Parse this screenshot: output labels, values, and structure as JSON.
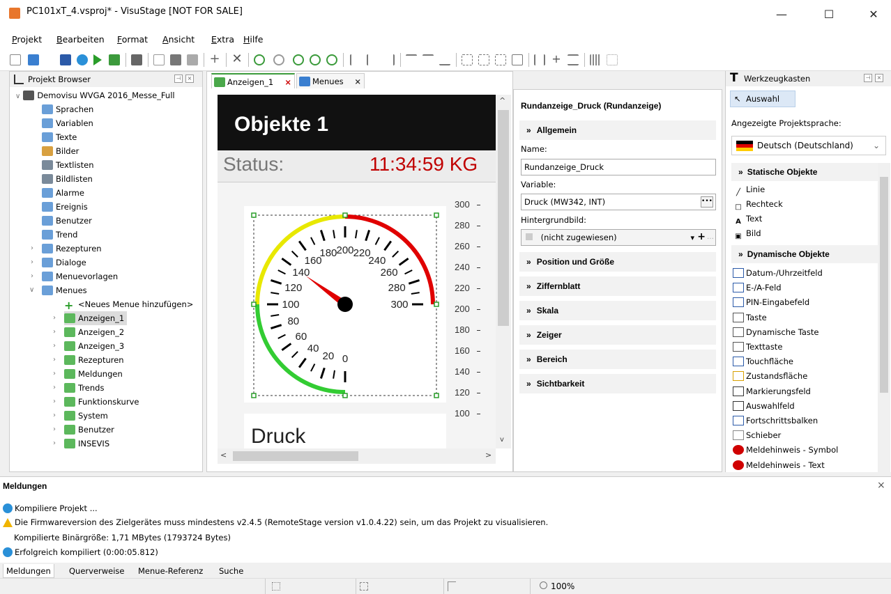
{
  "window": {
    "title": "PC101xT_4.vsproj* - VisuStage [NOT FOR SALE]",
    "min": "—",
    "max": "☐",
    "close": "✕"
  },
  "menubar": [
    {
      "first": "P",
      "rest": "rojekt"
    },
    {
      "first": "B",
      "rest": "earbeiten"
    },
    {
      "first": "F",
      "rest": "ormat"
    },
    {
      "first": "A",
      "rest": "nsicht"
    },
    {
      "first": "E",
      "rest": "xtra"
    },
    {
      "first": "H",
      "rest": "ilfe"
    }
  ],
  "project_browser": {
    "title": "Projekt Browser",
    "root": "Demovisu WVGA 2016_Messe_Full",
    "items": [
      "Sprachen",
      "Variablen",
      "Texte",
      "Bilder",
      "Textlisten",
      "Bildlisten",
      "Alarme",
      "Ereignis",
      "Benutzer",
      "Trend",
      "Rezepturen",
      "Dialoge",
      "Menuevorlagen",
      "Menues"
    ],
    "menu_items": [
      "<Neues Menue hinzufügen>",
      "Anzeigen_1",
      "Anzeigen_2",
      "Anzeigen_3",
      "Rezepturen",
      "Meldungen",
      "Trends",
      "Funktionskurve",
      "System",
      "Benutzer",
      "INSEVIS"
    ]
  },
  "tabs": [
    {
      "label": "Anzeigen_1",
      "close": "×"
    },
    {
      "label": "Menues",
      "close": "×"
    }
  ],
  "canvas": {
    "header": "Objekte 1",
    "status_label": "Status:",
    "time": "11:34:59 KG",
    "druck": "Druck",
    "scale_ticks": [
      "300",
      "280",
      "260",
      "240",
      "220",
      "200",
      "180",
      "160",
      "140",
      "120",
      "100"
    ],
    "gauge_labels": [
      "0",
      "20",
      "40",
      "60",
      "80",
      "100",
      "120",
      "140",
      "160",
      "180",
      "200",
      "220",
      "240",
      "260",
      "280",
      "300"
    ],
    "scroll_up": "^",
    "scroll_down": "v",
    "scroll_left": "<",
    "scroll_right": ">"
  },
  "properties": {
    "title": "Rundanzeige_Druck (Rundanzeige)",
    "section_general": "Allgemein",
    "name_label": "Name:",
    "name_value": "Rundanzeige_Druck",
    "variable_label": "Variable:",
    "variable_value": "Druck (MW342, INT)",
    "bg_label": "Hintergrundbild:",
    "bg_value": "(nicht zugewiesen)",
    "sections": [
      "Position und Größe",
      "Ziffernblatt",
      "Skala",
      "Zeiger",
      "Bereich",
      "Sichtbarkeit"
    ]
  },
  "toolbox": {
    "title": "Werkzeugkasten",
    "select": "Auswahl",
    "lang_label": "Angezeigte Projektsprache:",
    "lang_value": "Deutsch (Deutschland)",
    "static_header": "Statische Objekte",
    "static": [
      "Linie",
      "Rechteck",
      "Text",
      "Bild"
    ],
    "dynamic_header": "Dynamische Objekte",
    "dynamic": [
      "Datum-/Uhrzeitfeld",
      "E-/A-Feld",
      "PIN-Eingabefeld",
      "Taste",
      "Dynamische Taste",
      "Texttaste",
      "Touchfläche",
      "Zustandsfläche",
      "Markierungsfeld",
      "Auswahlfeld",
      "Fortschrittsbalken",
      "Schieber",
      "Meldehinweis - Symbol",
      "Meldehinweis - Text"
    ]
  },
  "messages": {
    "title": "Meldungen",
    "close": "×",
    "lines": [
      "Kompiliere Projekt ...",
      "Die Firmwareversion des Zielgerätes muss mindestens v2.4.5 (RemoteStage version v1.0.4.22) sein, um das Projekt zu visualisieren.",
      "Kompilierte Binärgröße: 1,71 MBytes (1793724 Bytes)",
      "Erfolgreich kompiliert (0:00:05.812)"
    ],
    "tabs": [
      "Meldungen",
      "Querverweise",
      "Menue-Referenz",
      "Suche"
    ]
  },
  "status": {
    "zoom": "100%"
  },
  "colors": {
    "gauge_green": "#33cc33",
    "gauge_yellow": "#e8e800",
    "gauge_red": "#e00000",
    "needle": "#e00000",
    "header_bg": "#111111"
  }
}
